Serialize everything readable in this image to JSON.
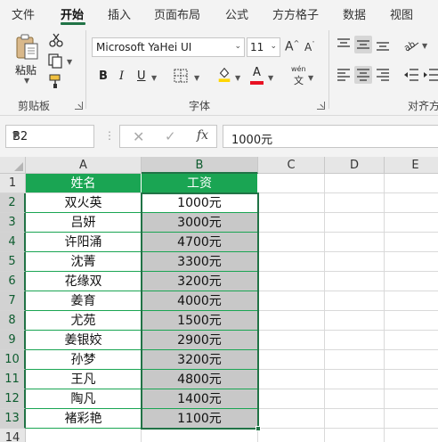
{
  "menu": {
    "tabs": [
      "文件",
      "开始",
      "插入",
      "页面布局",
      "公式",
      "方方格子",
      "数据",
      "视图"
    ],
    "active_tab": "开始"
  },
  "ribbon": {
    "clipboard": {
      "paste_label": "粘贴",
      "group_label": "剪贴板"
    },
    "font": {
      "font_name": "Microsoft YaHei UI",
      "font_size": "11",
      "bold": "B",
      "italic": "I",
      "underline": "U",
      "font_color_label": "A",
      "phonetic_label": "wén",
      "phonetic_char": "文",
      "grow_label": "A",
      "shrink_label": "A",
      "group_label": "字体"
    },
    "alignment": {
      "group_label": "对齐方"
    },
    "colors": {
      "accent": "#217346",
      "font_color_bar": "#e81123",
      "fill_color_bar": "#ffd600"
    }
  },
  "formula_bar": {
    "name_box": "B2",
    "fx_label": "fx",
    "value": "1000元"
  },
  "sheet": {
    "columns": [
      "A",
      "B",
      "C",
      "D",
      "E"
    ],
    "rows": [
      "1",
      "2",
      "3",
      "4",
      "5",
      "6",
      "7",
      "8",
      "9",
      "10",
      "11",
      "12",
      "13",
      "14"
    ],
    "header": {
      "name": "姓名",
      "salary": "工资"
    },
    "records": [
      {
        "name": "双火英",
        "salary": "1000元"
      },
      {
        "name": "吕妍",
        "salary": "3000元"
      },
      {
        "name": "许阳涌",
        "salary": "4700元"
      },
      {
        "name": "沈菁",
        "salary": "3300元"
      },
      {
        "name": "花缘双",
        "salary": "3200元"
      },
      {
        "name": "姜育",
        "salary": "4000元"
      },
      {
        "name": "尤苑",
        "salary": "1500元"
      },
      {
        "name": "姜银姣",
        "salary": "2900元"
      },
      {
        "name": "孙梦",
        "salary": "3200元"
      },
      {
        "name": "王凡",
        "salary": "4800元"
      },
      {
        "name": "陶凡",
        "salary": "1400元"
      },
      {
        "name": "褚彩艳",
        "salary": "1100元"
      }
    ],
    "header_fill": "#1aa553",
    "selected_fill": "#c8c8c8"
  }
}
